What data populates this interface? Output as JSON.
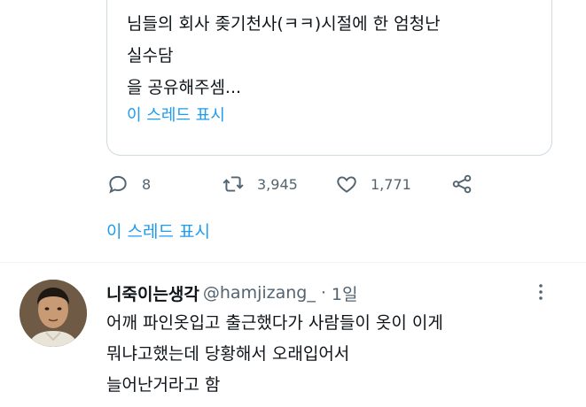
{
  "quoted_tweet": {
    "text": "님들의 회사 좆기천사(ㅋㅋ)시절에 한 엄청난\n실수담\n을 공유해주셈...",
    "show_thread": "이 스레드 표시"
  },
  "actions": {
    "reply_count": "8",
    "retweet_count": "3,945",
    "like_count": "1,771"
  },
  "show_thread_link": "이 스레드 표시",
  "reply_tweet": {
    "display_name": "니죽이는생각",
    "handle": "@hamjizang_",
    "separator": "·",
    "time": "1일",
    "text": "어깨 파인옷입고 출근했다가 사람들이 옷이 이게\n뭐냐고했는데 당황해서 오래입어서\n늘어난거라고 함"
  },
  "colors": {
    "link": "#1d9bf0",
    "muted": "#536471",
    "text": "#0f1419",
    "border": "#cfd9de"
  },
  "icons": {
    "reply": "comment-icon",
    "retweet": "retweet-icon",
    "like": "heart-icon",
    "share": "share-icon",
    "more": "more-dots-icon"
  }
}
